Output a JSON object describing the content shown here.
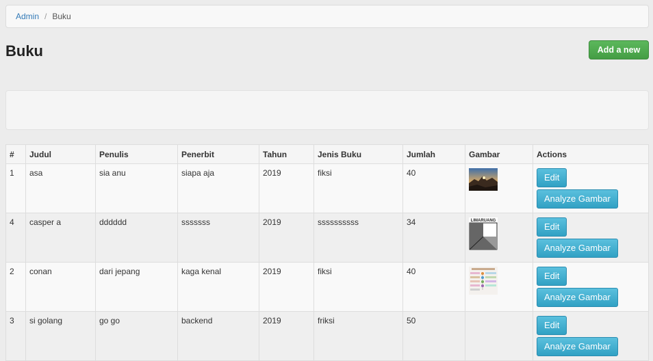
{
  "breadcrumb": {
    "root": "Admin",
    "current": "Buku"
  },
  "page": {
    "title": "Buku",
    "add_button": "Add a new"
  },
  "table": {
    "headers": [
      "#",
      "Judul",
      "Penulis",
      "Penerbit",
      "Tahun",
      "Jenis Buku",
      "Jumlah",
      "Gambar",
      "Actions"
    ],
    "edit_label": "Edit",
    "analyze_label": "Analyze Gambar",
    "rows": [
      {
        "id": "1",
        "judul": "asa",
        "penulis": "sia anu",
        "penerbit": "siapa aja",
        "tahun": "2019",
        "jenis": "fiksi",
        "jumlah": "40",
        "image": "landscape-photo"
      },
      {
        "id": "4",
        "judul": "casper a",
        "penulis": "dddddd",
        "penerbit": "sssssss",
        "tahun": "2019",
        "jenis": "ssssssssss",
        "jumlah": "34",
        "image": "limaruang-logo",
        "image_text": "LIMARUANG"
      },
      {
        "id": "2",
        "judul": "conan",
        "penulis": "dari jepang",
        "penerbit": "kaga kenal",
        "tahun": "2019",
        "jenis": "fiksi",
        "jumlah": "40",
        "image": "infographic"
      },
      {
        "id": "3",
        "judul": "si golang",
        "penulis": "go go",
        "penerbit": "backend",
        "tahun": "2019",
        "jenis": "friksi",
        "jumlah": "50",
        "image": ""
      }
    ]
  },
  "colors": {
    "primary_link": "#337ab7",
    "success": "#5cb85c",
    "info": "#5bc0de"
  }
}
